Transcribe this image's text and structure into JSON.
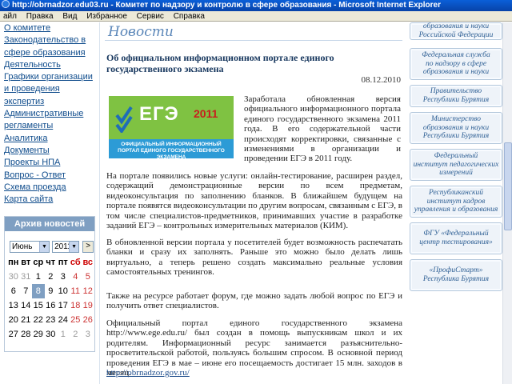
{
  "window": {
    "title": "http://obrnadzor.edu03.ru - Комитет по надзору и контролю в сфере образования - Microsoft Internet Explorer"
  },
  "menu": {
    "items": [
      "айл",
      "Правка",
      "Вид",
      "Избранное",
      "Сервис",
      "Справка"
    ]
  },
  "nav": {
    "items": [
      "О комитете",
      "Законодательство в сфере образования",
      "Деятельность",
      "Графики организации и проведения экспертиз",
      "Административные регламенты",
      "Аналитика",
      "Документы",
      "Проекты НПА",
      "Вопрос - Ответ",
      "Схема проезда",
      "Карта сайта"
    ]
  },
  "archive": {
    "title": "Архив новостей",
    "month": "Июнь",
    "year": "2011",
    "go_label": ">",
    "weekdays": [
      "пн",
      "вт",
      "ср",
      "чт",
      "пт",
      "сб",
      "вс"
    ],
    "weeks": [
      [
        "30",
        "31",
        "1",
        "2",
        "3",
        "4",
        "5"
      ],
      [
        "6",
        "7",
        "8",
        "9",
        "10",
        "11",
        "12"
      ],
      [
        "13",
        "14",
        "15",
        "16",
        "17",
        "18",
        "19"
      ],
      [
        "20",
        "21",
        "22",
        "23",
        "24",
        "25",
        "26"
      ],
      [
        "27",
        "28",
        "29",
        "30",
        "1",
        "2",
        "3"
      ]
    ],
    "current_day": "8"
  },
  "main": {
    "section_title": "Новости",
    "article": {
      "title": "Об официальном информационном портале единого государственного экзамена",
      "date": "08.12.2010",
      "image": {
        "logo": "ЕГЭ",
        "year": "2011",
        "caption": "ОФИЦИАЛЬНЫЙ ИНФОРМАЦИОННЫЙ ПОРТАЛ ЕДИНОГО ГОСУДАРСТВЕННОГО ЭКЗАМЕНА"
      },
      "paragraphs": [
        "Заработала обновленная версия официального информационного портала единого государственного экзамена 2011 года. В его содержательной части происходят корректировки, связанные с изменениями в организации и проведении ЕГЭ в 2011 году.",
        "На портале появились новые услуги: онлайн-тестирование, расширен раздел, содержащий демонстрационные версии по всем предметам, видеоконсультация по заполнению бланков. В ближайшем будущем на портале появятся видеоконсультации по другим вопросам, связанным с ЕГЭ, в том числе специалистов-предметников, принимавших участие в разработке заданий ЕГЭ – контрольных измерительных материалов (КИМ).",
        "В обновленной версии портала у посетителей будет возможность распечатать бланки и сразу их заполнять. Раньше это можно было делать лишь виртуально, а теперь решено создать максимально реальные условия самостоятельных тренингов.",
        "Также на ресурсе работает форум, где можно задать любой вопрос по ЕГЭ и получить ответ специалистов.",
        "Официальный портал единого государственного экзамена http://www.ege.edu.ru/ был создан в помощь выпускникам школ и их родителям. Информационный ресурс занимается разъяснительно-просветительской работой, пользуясь большим спросом. В основной период проведения ЕГЭ в мае – июне его посещаемость достигает 15 млн. заходов в месяц."
      ],
      "link": "http://obrnadzor.gov.ru/"
    }
  },
  "sidebar_links": [
    [
      "образования и науки",
      "Российской Федерации"
    ],
    [
      "Федеральная служба",
      "по надзору в сфере",
      "образования и науки"
    ],
    [
      "Правительство",
      "Республики Бурятия"
    ],
    [
      "Министерство",
      "образования и науки",
      "Республики Бурятия"
    ],
    [
      "Федеральный",
      "институт педагогических",
      "измерений"
    ],
    [
      "Республиканский",
      "институт кадров",
      "управления и образования"
    ],
    [
      "ФГУ «Федеральный",
      "центр тестирования»"
    ],
    [
      "«ПрофиСтарт»",
      "Республика Бурятия"
    ]
  ]
}
